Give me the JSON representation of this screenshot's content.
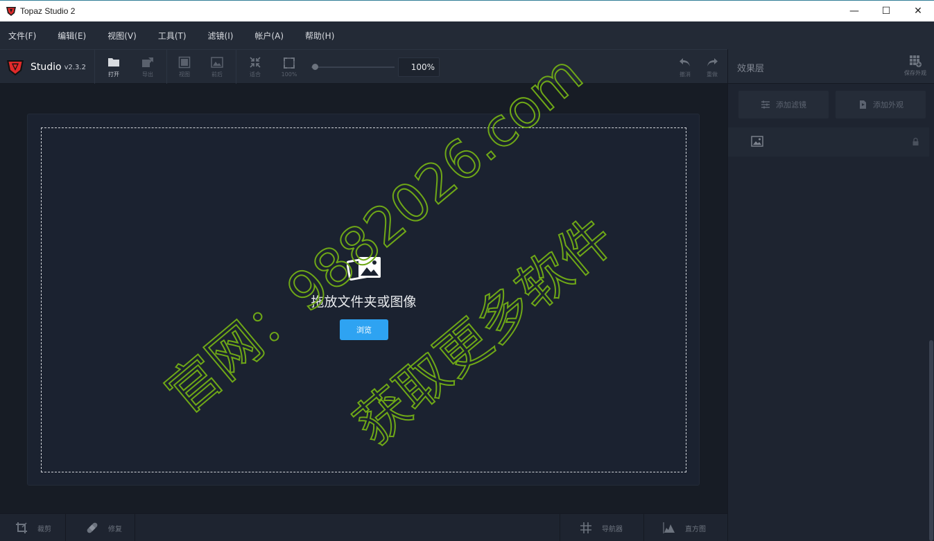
{
  "window": {
    "title": "Topaz Studio 2",
    "controls": {
      "minimize": "—",
      "maximize": "☐",
      "close": "✕"
    }
  },
  "menu": [
    "文件(F)",
    "编辑(E)",
    "视图(V)",
    "工具(T)",
    "滤镜(I)",
    "帐户(A)",
    "帮助(H)"
  ],
  "brand": {
    "name": "Studio",
    "version": "v2.3.2"
  },
  "toolbar": {
    "open": "打开",
    "export": "导出",
    "view": "视图",
    "compare": "前后",
    "fit": "适合",
    "zoom100": "100%",
    "zoom_value": "100%",
    "undo": "撤消",
    "redo": "重做"
  },
  "right_panel": {
    "title": "效果层",
    "save_look": "保存外观",
    "add_filter": "添加滤镜",
    "add_look": "添加外观"
  },
  "canvas": {
    "drop_text": "拖放文件夹或图像",
    "browse": "浏览"
  },
  "bottom": {
    "crop": "裁剪",
    "repair": "修复",
    "navigator": "导航器",
    "histogram": "直方图"
  },
  "watermark": {
    "line1": "官网：9882026.com",
    "line2": "获取更多软件"
  },
  "colors": {
    "accent": "#2ea3f2",
    "background": "#1a1f29",
    "watermark": "#6fa817"
  }
}
